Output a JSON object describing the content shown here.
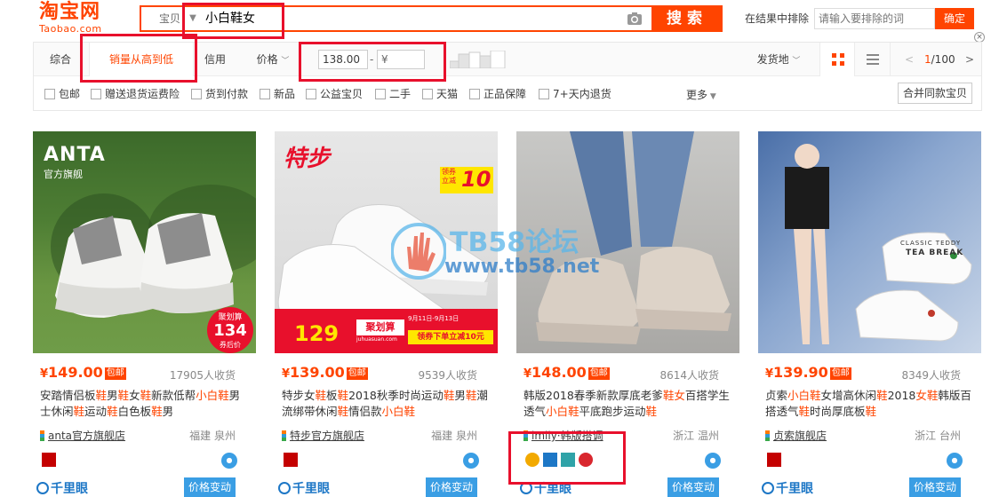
{
  "header": {
    "logo_main": "淘宝网",
    "logo_sub": "Taobao.com",
    "search_type": "宝贝",
    "search_value": "小白鞋女",
    "search_button": "搜索",
    "exclude_label": "在结果中排除",
    "exclude_placeholder": "请输入要排除的词",
    "exclude_button": "确定"
  },
  "sort": {
    "tabs": [
      "综合",
      "销量从高到低",
      "信用"
    ],
    "price_label": "价格",
    "price_min": "138.00",
    "price_dash": "-",
    "price_max_placeholder": "¥",
    "ship_from": "发货地",
    "page_current": "1",
    "page_total": "/100"
  },
  "filters": [
    "包邮",
    "赠送退货运费险",
    "货到付款",
    "新品",
    "公益宝贝",
    "二手",
    "天猫",
    "正品保障",
    "7+天内退货"
  ],
  "filters_more": "更多",
  "merge_button": "合并同款宝贝",
  "products": [
    {
      "yen": "¥",
      "price": "149.00",
      "tag": "包邮",
      "sales": "17905人收货",
      "title": [
        "安踏情侣板",
        "鞋",
        "男",
        "鞋",
        "女",
        "鞋",
        "新款低帮",
        "小白鞋",
        "男士休闲",
        "鞋",
        "运动",
        "鞋",
        "白色板",
        "鞋",
        "男"
      ],
      "shop": "anta官方旗舰店",
      "location": "福建 泉州",
      "img_brand": "ANTA",
      "img_brand_sub": "官方旗舰",
      "img_badge_top": "聚划算",
      "img_badge_price": "134",
      "img_badge_sub": "券后价",
      "qianliyan": "千里眼",
      "change_button": "价格变动"
    },
    {
      "yen": "¥",
      "price": "139.00",
      "tag": "包邮",
      "sales": "9539人收货",
      "title": [
        "特步女",
        "鞋",
        "板",
        "鞋",
        "2018秋季时尚运动",
        "鞋",
        "男",
        "鞋",
        "潮流绑带休闲",
        "鞋",
        "情侣款",
        "小白鞋",
        "",
        "",
        ""
      ],
      "shop": "特步官方旗舰店",
      "location": "福建 泉州",
      "img_brand": "特步",
      "img_coupon_top": "领券立减",
      "img_coupon_num": "10",
      "img_price": "129",
      "img_juhuasuan": "聚划算",
      "img_site": "juhuasuan.com",
      "img_date": "9月11日-9月13日",
      "img_coupon_bottom": "领券下单立减10元",
      "qianliyan": "千里眼",
      "change_button": "价格变动"
    },
    {
      "yen": "¥",
      "price": "148.00",
      "tag": "包邮",
      "sales": "8614人收货",
      "title": [
        "韩版2018春季新款厚底老爹",
        "鞋",
        "女",
        "百搭学生透气",
        "小白鞋",
        "平底跑步运动",
        "鞋",
        "",
        "",
        "",
        "",
        "",
        "",
        "",
        ""
      ],
      "shop": "imily·韩版搭调",
      "location": "浙江 温州",
      "qianliyan": "千里眼",
      "change_button": "价格变动"
    },
    {
      "yen": "¥",
      "price": "139.90",
      "tag": "包邮",
      "sales": "8349人收货",
      "title": [
        "贞索",
        "小白鞋",
        "女增高休闲",
        "鞋",
        "2018",
        "女",
        "鞋",
        "韩版百搭透气",
        "鞋",
        "时尚厚底板",
        "鞋",
        "",
        "",
        "",
        ""
      ],
      "shop": "贞索旗舰店",
      "location": "浙江 台州",
      "img_text1": "CLASSIC TEDDY",
      "img_text2": "TEA BREAK",
      "qianliyan": "千里眼",
      "change_button": "价格变动"
    }
  ],
  "watermark": {
    "title": "TB58论坛",
    "url": "www.tb58.net"
  },
  "colors": {
    "accent": "#ff4400",
    "highlight_box": "#e8102c",
    "link_blue": "#3a9ee4"
  }
}
